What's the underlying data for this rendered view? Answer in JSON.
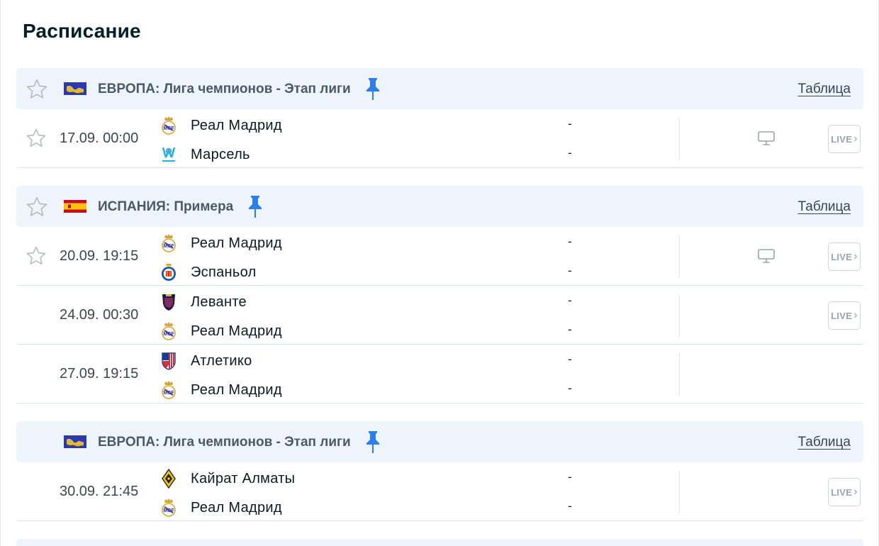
{
  "page": {
    "title": "Расписание"
  },
  "colors": {
    "accent_pin": "#2f7ee6",
    "header_bg": "#eef4fc",
    "star_outline": "#b9c1c5"
  },
  "icons": {
    "star": "star-outline-icon",
    "pin": "pin-icon",
    "tv": "tv-icon",
    "live_chevron": "chevron-right-icon"
  },
  "sections": [
    {
      "league": "ЕВРОПА: Лига чемпионов - Этап лиги",
      "flag": "europe",
      "table_label": "Таблица",
      "show_star": true,
      "matches": [
        {
          "time": "17.09. 00:00",
          "home": "Реал Мадрид",
          "home_logo": "real-madrid",
          "away": "Марсель",
          "away_logo": "marseille",
          "home_score": "-",
          "away_score": "-",
          "star": true,
          "tv": true,
          "live": "LIVE"
        }
      ]
    },
    {
      "league": "ИСПАНИЯ: Примера",
      "flag": "spain",
      "table_label": "Таблица",
      "show_star": true,
      "matches": [
        {
          "time": "20.09. 19:15",
          "home": "Реал Мадрид",
          "home_logo": "real-madrid",
          "away": "Эспаньол",
          "away_logo": "espanyol",
          "home_score": "-",
          "away_score": "-",
          "star": true,
          "tv": true,
          "live": "LIVE"
        },
        {
          "time": "24.09. 00:30",
          "home": "Леванте",
          "home_logo": "levante",
          "away": "Реал Мадрид",
          "away_logo": "real-madrid",
          "home_score": "-",
          "away_score": "-",
          "star": false,
          "tv": false,
          "live": "LIVE"
        },
        {
          "time": "27.09. 19:15",
          "home": "Атлетико",
          "home_logo": "atletico",
          "away": "Реал Мадрид",
          "away_logo": "real-madrid",
          "home_score": "-",
          "away_score": "-",
          "star": false,
          "tv": false,
          "live": ""
        }
      ]
    },
    {
      "league": "ЕВРОПА: Лига чемпионов - Этап лиги",
      "flag": "europe",
      "table_label": "Таблица",
      "show_star": false,
      "matches": [
        {
          "time": "30.09. 21:45",
          "home": "Кайрат Алматы",
          "home_logo": "kairat",
          "away": "Реал Мадрид",
          "away_logo": "real-madrid",
          "home_score": "-",
          "away_score": "-",
          "star": false,
          "tv": false,
          "live": "LIVE"
        }
      ]
    }
  ]
}
